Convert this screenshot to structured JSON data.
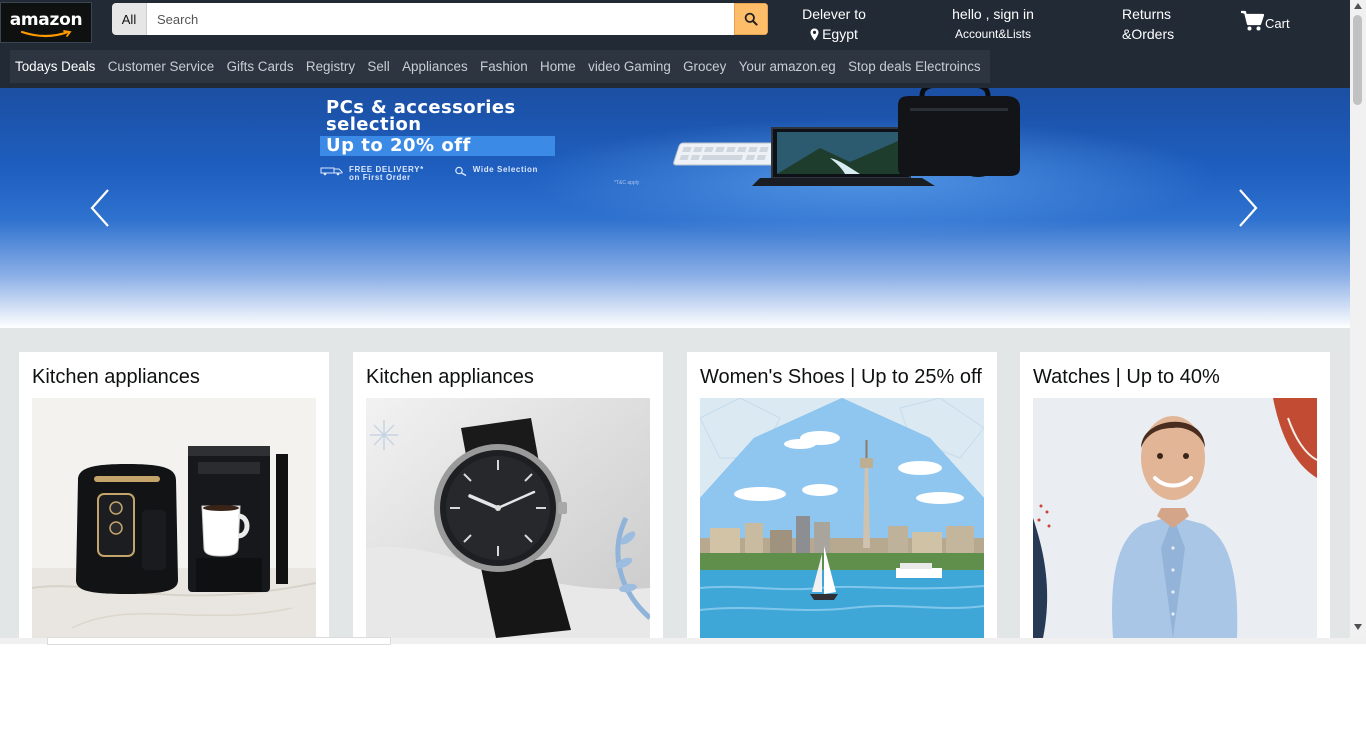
{
  "header": {
    "logo_text": "amazon",
    "search": {
      "category": "All",
      "placeholder": "Search"
    },
    "deliver": {
      "line1": "Delever to",
      "line2": "Egypt"
    },
    "account": {
      "line1": "hello , sign in",
      "line2": "Account&Lists"
    },
    "returns": {
      "line1": "Returns",
      "line2": "&Orders"
    },
    "cart": {
      "label": "Cart"
    }
  },
  "subnav": {
    "items": [
      "Todays Deals",
      "Customer Service",
      "Gifts Cards",
      "Registry",
      "Sell",
      "Appliances",
      "Fashion",
      "Home",
      "video Gaming",
      "Grocey",
      "Your amazon.eg",
      "Stop deals Electroincs"
    ]
  },
  "hero": {
    "title_line1": "PCs & accessories",
    "title_line2": "selection",
    "offer": "Up to 20% off",
    "feature1_line1": "FREE DELIVERY*",
    "feature1_line2": "on First Order",
    "feature2": "Wide Selection",
    "tc": "*T&C apply"
  },
  "cards": [
    {
      "title": "Kitchen appliances",
      "image": "air-fryer-and-coffee-maker"
    },
    {
      "title": "Kitchen appliances",
      "image": "black-wristwatch"
    },
    {
      "title": "Women's Shoes | Up to 25% off",
      "image": "cairo-tower-nile-sailboat"
    },
    {
      "title": "Watches | Up to 40%",
      "image": "man-in-blue-shirt"
    }
  ],
  "colors": {
    "nav_bg": "#222a35",
    "subnav_bg": "#2d3541",
    "search_button": "#febd69",
    "page_bg": "#e3e6e6"
  }
}
